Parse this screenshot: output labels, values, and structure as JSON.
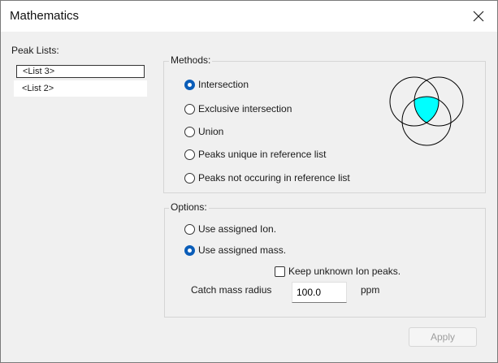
{
  "window": {
    "title": "Mathematics"
  },
  "peak_lists": {
    "label": "Peak Lists:",
    "items": [
      "<List 3>",
      "<List 2>"
    ]
  },
  "methods": {
    "label": "Methods:",
    "options": [
      {
        "label": "Intersection",
        "checked": true
      },
      {
        "label": "Exclusive intersection",
        "checked": false
      },
      {
        "label": "Union",
        "checked": false
      },
      {
        "label": "Peaks unique in reference list",
        "checked": false
      },
      {
        "label": "Peaks not occuring in reference list",
        "checked": false
      }
    ],
    "venn_fill_color": "#00ffff"
  },
  "options": {
    "label": "Options:",
    "radios": [
      {
        "label": "Use assigned Ion.",
        "checked": false
      },
      {
        "label": "Use assigned mass.",
        "checked": true
      }
    ],
    "keep_unknown": {
      "label": "Keep unknown Ion peaks.",
      "checked": false
    },
    "catch_label": "Catch mass radius",
    "catch_value": "100.0",
    "unit": "ppm"
  },
  "buttons": {
    "apply": "Apply"
  },
  "colors": {
    "accent": "#0a5db8",
    "disabled_text": "#9e9e9e"
  }
}
